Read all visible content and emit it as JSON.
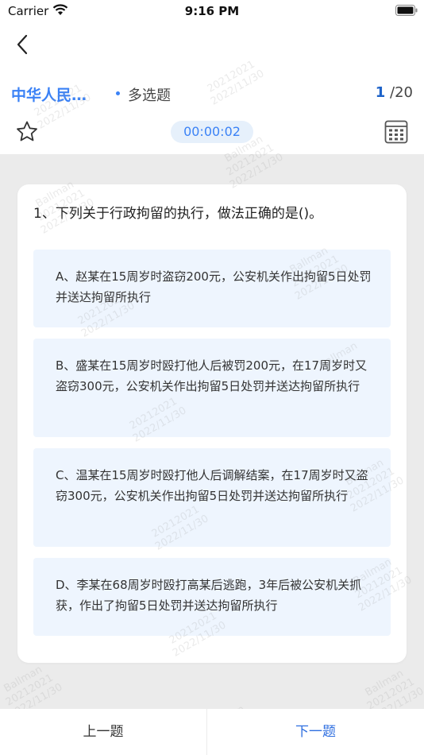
{
  "status_bar": {
    "carrier": "Carrier",
    "time": "9:16 PM"
  },
  "header": {
    "category": "中华人民…",
    "question_type": "多选题",
    "progress_current": "1",
    "progress_total": "/20",
    "timer": "00:00:02"
  },
  "question": {
    "text": "1、下列关于行政拘留的执行，做法正确的是()。",
    "options": [
      {
        "label": "A、赵某在15周岁时盗窃200元，公安机关作出拘留5日处罚并送达拘留所执行"
      },
      {
        "label": "B、盛某在15周岁时殴打他人后被罚200元，在17周岁时又盗窃300元，公安机关作出拘留5日处罚并送达拘留所执行"
      },
      {
        "label": "C、温某在15周岁时殴打他人后调解结案，在17周岁时又盗窃300元，公安机关作出拘留5日处罚并送达拘留所执行"
      },
      {
        "label": "D、李某在68周岁时殴打高某后逃跑，3年后被公安机关抓获，作出了拘留5日处罚并送达拘留所执行"
      }
    ]
  },
  "footer": {
    "prev_label": "上一题",
    "next_label": "下一题"
  },
  "watermark": {
    "name": "Ballman",
    "id": "20212021",
    "date": "2022/11/30"
  },
  "colors": {
    "accent": "#3b82f6",
    "option_bg": "#eef5fe",
    "page_bg": "#ebebeb"
  },
  "icons": [
    "wifi-icon",
    "battery-icon",
    "back-chevron-icon",
    "star-icon",
    "answer-sheet-grid-icon"
  ]
}
